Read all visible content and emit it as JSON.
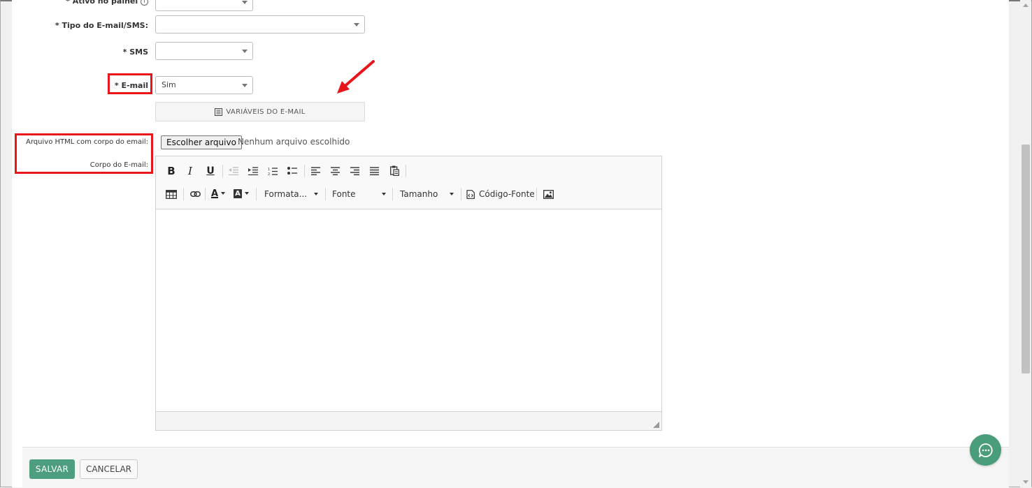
{
  "colors": {
    "highlight_red": "#e8161b",
    "save_green": "#4d9e7f",
    "chat_green": "#4a9d7a"
  },
  "form": {
    "ativo_label": "* Ativo no painel",
    "tipo_label": "* Tipo do E-mail/SMS:",
    "tipo_value": "",
    "sms_label": "* SMS",
    "sms_value": "",
    "email_label": "* E-mail",
    "email_value": "Sim",
    "vars_button": "VARIÁVEIS DO E-MAIL",
    "arquivo_label": "Arquivo HTML com corpo do email:",
    "file_button": "Escolher arquivo",
    "file_status": "Nenhum arquivo escolhido",
    "corpo_label": "Corpo do E-mail:"
  },
  "editor": {
    "bold": "B",
    "italic": "I",
    "underline": "U",
    "format_dropdown": "Formata...",
    "font_dropdown": "Fonte",
    "size_dropdown": "Tamanho",
    "source_button": "Código-Fonte",
    "text_color_glyph": "A",
    "bg_color_glyph": "A",
    "icons": [
      "bold-icon",
      "italic-icon",
      "underline-icon",
      "outdent-icon",
      "indent-icon",
      "numbered-list-icon",
      "bullet-list-icon",
      "align-left-icon",
      "align-center-icon",
      "align-right-icon",
      "align-justify-icon",
      "paste-icon",
      "table-icon",
      "link-icon",
      "text-color-icon",
      "background-color-icon",
      "source-code-icon",
      "image-icon"
    ]
  },
  "footer": {
    "save": "SALVAR",
    "cancel": "CANCELAR"
  },
  "chat": {
    "icon": "chat-bubble-icon"
  }
}
